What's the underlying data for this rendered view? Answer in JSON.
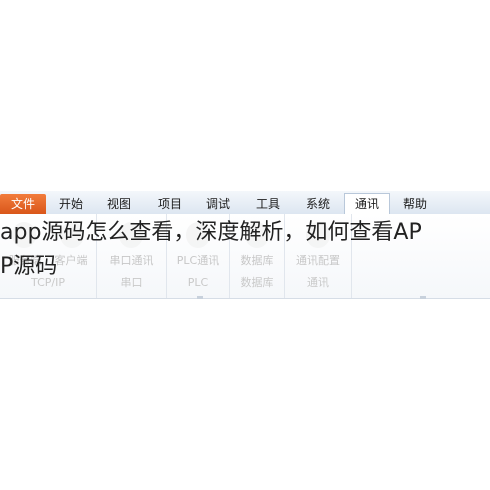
{
  "menubar": {
    "file_label": "文件",
    "items": [
      "开始",
      "视图",
      "项目",
      "调试",
      "工具",
      "系统",
      "通讯",
      "帮助"
    ]
  },
  "ribbon": {
    "buttons": [
      "服务端",
      "客户端",
      "串口通讯",
      "PLC通讯",
      "数据库",
      "通讯配置"
    ],
    "group_labels": [
      "TCP/IP",
      "串口",
      "PLC",
      "数据库",
      "通讯"
    ]
  },
  "caption": {
    "line1": "app源码怎么查看，深度解析，如何查看AP",
    "line2": "P源码"
  },
  "colors": {
    "file_tab": "#e8692a",
    "menubar_bg": "#e4ebf4",
    "caption_text": "#222222"
  }
}
